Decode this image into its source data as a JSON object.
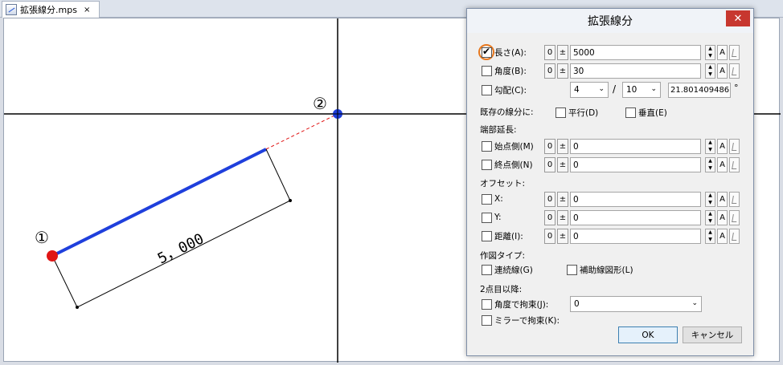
{
  "tab": {
    "title": "拡張線分.mps",
    "close": "×"
  },
  "canvas": {
    "marker1": "①",
    "marker2": "②",
    "dimension": "5，000"
  },
  "dialog": {
    "title": "拡張線分",
    "close": "✕",
    "length": {
      "label": "長さ(A):",
      "checked": true,
      "zero": "0",
      "pm": "±",
      "value": "5000",
      "a": "A"
    },
    "angle": {
      "label": "角度(B):",
      "zero": "0",
      "pm": "±",
      "value": "30",
      "a": "A"
    },
    "slope": {
      "label": "勾配(C):",
      "num": "4",
      "slash": "/",
      "den": "10",
      "result": "21.801409486",
      "deg": "°"
    },
    "existing": {
      "label": "既存の線分に:",
      "parallel": "平行(D)",
      "perpendicular": "垂直(E)"
    },
    "extend": {
      "heading": "端部延長:",
      "start": {
        "label": "始点側(M)",
        "zero": "0",
        "pm": "±",
        "value": "0",
        "a": "A"
      },
      "end": {
        "label": "終点側(N)",
        "zero": "0",
        "pm": "±",
        "value": "0",
        "a": "A"
      }
    },
    "offset": {
      "heading": "オフセット:",
      "x": {
        "label": "X:",
        "zero": "0",
        "pm": "±",
        "value": "0",
        "a": "A"
      },
      "y": {
        "label": "Y:",
        "zero": "0",
        "pm": "±",
        "value": "0",
        "a": "A"
      },
      "dist": {
        "label": "距離(I):",
        "zero": "0",
        "pm": "±",
        "value": "0",
        "a": "A"
      }
    },
    "drawtype": {
      "heading": "作図タイプ:",
      "continuous": "連続線(G)",
      "aux": "補助線図形(L)"
    },
    "second": {
      "heading": "2点目以降:",
      "angle_constraint": "角度で拘束(J):",
      "angle_value": "0",
      "mirror_constraint": "ミラーで拘束(K):"
    },
    "ok": "OK",
    "cancel": "キャンセル"
  },
  "colors": {
    "accent_line": "#1f3fdc",
    "point": "#e01515",
    "highlight": "#e8781e"
  }
}
